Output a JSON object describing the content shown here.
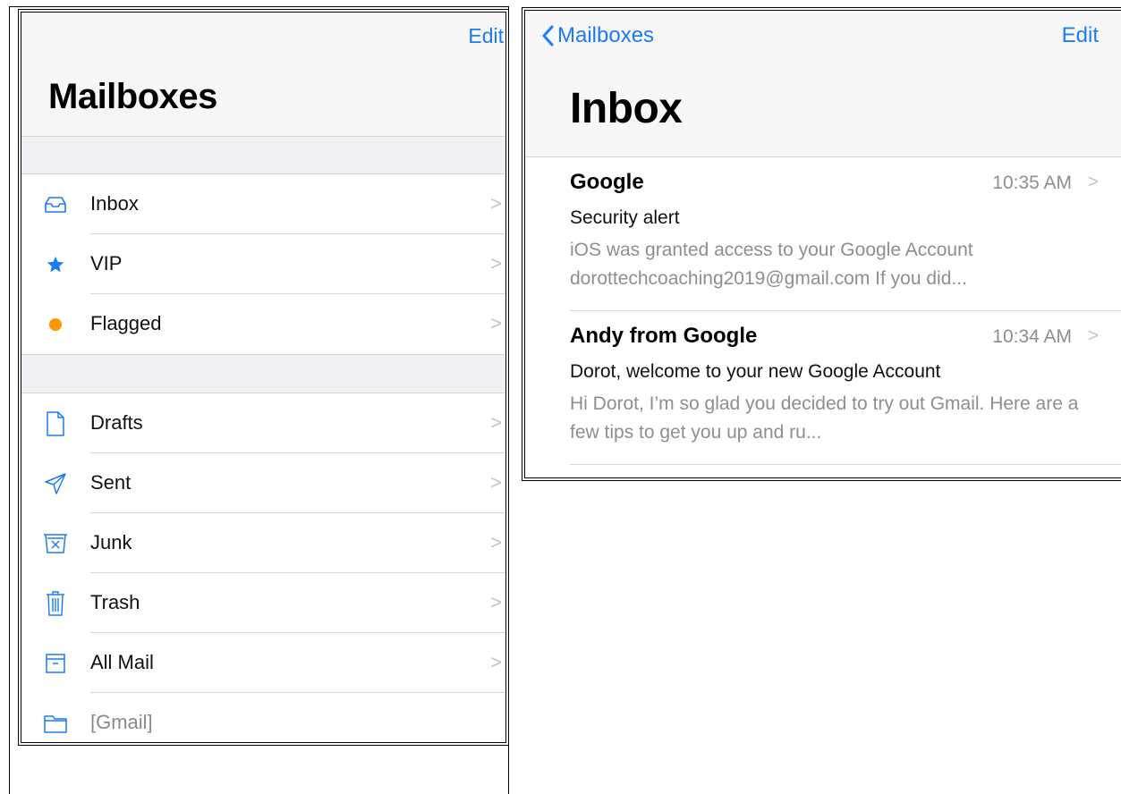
{
  "mailboxes_panel": {
    "edit_label": "Edit",
    "title": "Mailboxes",
    "group1": [
      {
        "label": "Inbox",
        "icon": "inbox-tray-icon"
      },
      {
        "label": "VIP",
        "icon": "star-icon"
      },
      {
        "label": "Flagged",
        "icon": "orange-dot-icon"
      }
    ],
    "group2": [
      {
        "label": "Drafts",
        "icon": "document-icon"
      },
      {
        "label": "Sent",
        "icon": "paper-plane-icon"
      },
      {
        "label": "Junk",
        "icon": "junk-box-icon"
      },
      {
        "label": "Trash",
        "icon": "trash-icon"
      },
      {
        "label": "All Mail",
        "icon": "archive-icon"
      },
      {
        "label": "[Gmail]",
        "icon": "folder-icon"
      }
    ],
    "chevron": ">"
  },
  "inbox_panel": {
    "back_label": "Mailboxes",
    "edit_label": "Edit",
    "title": "Inbox",
    "messages": [
      {
        "sender": "Google",
        "time": "10:35 AM",
        "subject": "Security alert",
        "preview": "iOS was granted access to your Google Account dorottechcoaching2019@gmail.com If you did..."
      },
      {
        "sender": "Andy from Google",
        "time": "10:34 AM",
        "subject": "Dorot, welcome to your new Google Account",
        "preview": "Hi Dorot, I’m so glad you decided to try out Gmail. Here are a few tips to get you up and ru..."
      }
    ]
  },
  "colors": {
    "accent": "#1a7cf6",
    "flag": "#ff9500",
    "separator": "#d6d6d8",
    "group_bg": "#efeff4"
  }
}
